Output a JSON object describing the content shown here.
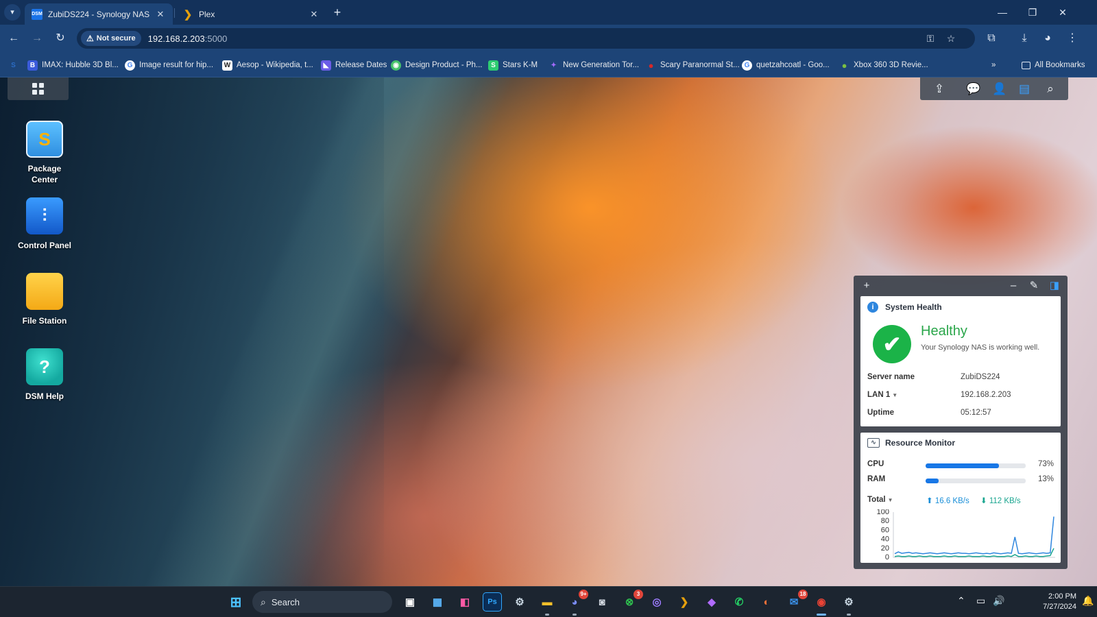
{
  "browser": {
    "tabs": [
      {
        "title": "ZubiDS224 - Synology NAS",
        "favicon": "dsm-favicon",
        "favicon_text": "DSM",
        "active": true
      },
      {
        "title": "Plex",
        "favicon": "plex-favicon",
        "active": false
      }
    ],
    "omnibox": {
      "security_label": "Not secure",
      "url_host": "192.168.2.203",
      "url_port": ":5000"
    },
    "bookmarks": [
      {
        "label": "IMAX: Hubble 3D Bl...",
        "icon": "B",
        "color": "#3b5bdb"
      },
      {
        "label": "Image result for hip...",
        "icon": "G",
        "color": "#4285f4"
      },
      {
        "label": "Aesop - Wikipedia, t...",
        "icon": "W",
        "color": "#ffffff"
      },
      {
        "label": "Release Dates",
        "icon": "◣",
        "color": "#6c5ce7"
      },
      {
        "label": "Design Product - Ph...",
        "icon": "◉",
        "color": "#46c36b"
      },
      {
        "label": "Stars K-M",
        "icon": "S",
        "color": "#2ecc71"
      },
      {
        "label": "New Generation Tor...",
        "icon": "✦",
        "color": "#a36bff"
      },
      {
        "label": "Scary Paranormal St...",
        "icon": "●",
        "color": "#d62828"
      },
      {
        "label": "quetzahcoatl - Goo...",
        "icon": "G",
        "color": "#4285f4"
      },
      {
        "label": "Xbox 360 3D Revie...",
        "icon": "●",
        "color": "#7bc043"
      }
    ],
    "all_bookmarks_label": "All Bookmarks"
  },
  "desktop": {
    "apps": [
      {
        "label": "Package Center",
        "name": "package-center-icon",
        "glyph": "S"
      },
      {
        "label": "Control Panel",
        "name": "control-panel-icon",
        "glyph": "⫶"
      },
      {
        "label": "File Station",
        "name": "file-station-icon",
        "glyph": ""
      },
      {
        "label": "DSM Help",
        "name": "dsm-help-icon",
        "glyph": "?"
      }
    ]
  },
  "system_health": {
    "title": "System Health",
    "status": "Healthy",
    "description": "Your Synology NAS is working well.",
    "rows": [
      {
        "key": "Server name",
        "value": "ZubiDS224"
      },
      {
        "key": "LAN 1",
        "value": "192.168.2.203"
      },
      {
        "key": "Uptime",
        "value": "05:12:57"
      }
    ]
  },
  "resource_monitor": {
    "title": "Resource Monitor",
    "cpu": {
      "label": "CPU",
      "percent": 73,
      "percent_text": "73%"
    },
    "ram": {
      "label": "RAM",
      "percent": 13,
      "percent_text": "13%"
    },
    "network": {
      "label": "Total",
      "upload": "16.6 KB/s",
      "download": "112 KB/s"
    },
    "chart_data": {
      "type": "line",
      "ylim": [
        0,
        100
      ],
      "yticks": [
        "100",
        "80",
        "60",
        "40",
        "20",
        "0"
      ],
      "series": [
        {
          "color": "#2e86de",
          "values": [
            8,
            12,
            9,
            10,
            11,
            9,
            10,
            9,
            8,
            9,
            10,
            9,
            8,
            9,
            10,
            9,
            8,
            9,
            10,
            9,
            9,
            8,
            9,
            10,
            9,
            8,
            9,
            8,
            10,
            9,
            8,
            9,
            10,
            9,
            45,
            9,
            8,
            9,
            10,
            9,
            8,
            9,
            10,
            9,
            10,
            90
          ]
        },
        {
          "color": "#19a58f",
          "values": [
            2,
            3,
            2,
            2,
            3,
            2,
            2,
            3,
            2,
            2,
            3,
            2,
            2,
            2,
            3,
            2,
            2,
            3,
            2,
            2,
            2,
            3,
            2,
            2,
            2,
            3,
            2,
            2,
            3,
            2,
            2,
            2,
            3,
            2,
            6,
            2,
            2,
            3,
            2,
            2,
            3,
            2,
            2,
            3,
            4,
            20
          ]
        }
      ]
    }
  },
  "taskbar": {
    "search_placeholder": "Search",
    "time": "2:00 PM",
    "date": "7/27/2024",
    "badges": {
      "discord": "9+",
      "xbox": "3",
      "outlook": "18"
    }
  }
}
